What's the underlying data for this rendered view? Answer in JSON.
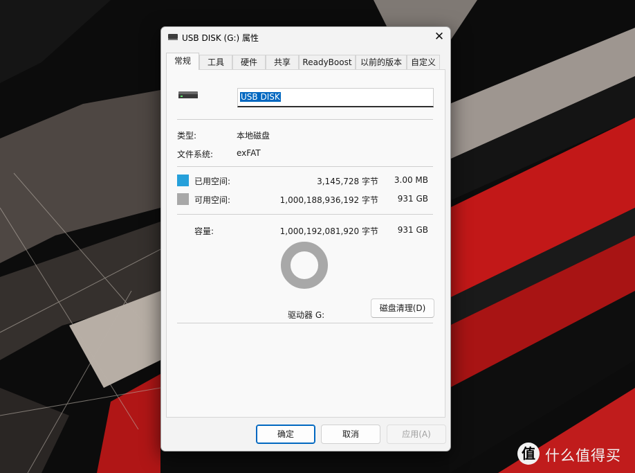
{
  "window": {
    "title": "USB DISK (G:) 属性",
    "close_glyph": "✕",
    "icon": "usb-drive-icon"
  },
  "tabs": [
    "常规",
    "工具",
    "硬件",
    "共享",
    "ReadyBoost",
    "以前的版本",
    "自定义"
  ],
  "active_tab": "常规",
  "general": {
    "drive_name": "USB DISK",
    "type_label": "类型:",
    "type_value": "本地磁盘",
    "fs_label": "文件系统:",
    "fs_value": "exFAT",
    "used": {
      "label": "已用空间:",
      "bytes": "3,145,728 字节",
      "size": "3.00 MB",
      "color": "#26a0da"
    },
    "free": {
      "label": "可用空间:",
      "bytes": "1,000,188,936,192 字节",
      "size": "931 GB",
      "color": "#a8a8a8"
    },
    "capacity": {
      "label": "容量:",
      "bytes": "1,000,192,081,920 字节",
      "size": "931 GB"
    },
    "drive_label": "驱动器 G:",
    "cleanup_button": "磁盘清理(D)",
    "used_fraction": 3.1e-06
  },
  "buttons": {
    "ok": "确定",
    "cancel": "取消",
    "apply": "应用(A)"
  },
  "watermark": {
    "logo_glyph": "值",
    "text": "什么值得买"
  }
}
